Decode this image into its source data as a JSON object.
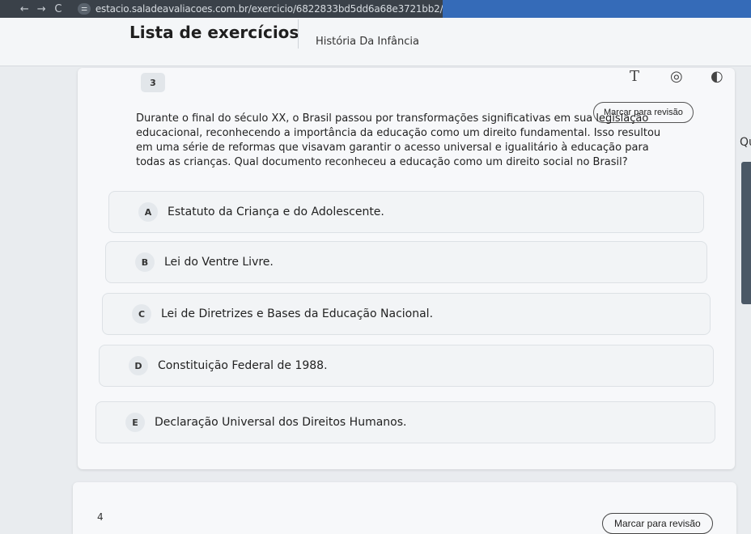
{
  "browser": {
    "url": "estacio.saladeavaliacoes.com.br/exercicio/6822833bd5dd6a68e3721bb2/",
    "back_icon": "←",
    "forward_icon": "→",
    "reload_icon": "C",
    "site_info_icon": "⚌"
  },
  "header": {
    "title": "Lista de exercícios",
    "subject": "História Da Infância"
  },
  "question": {
    "number": "3",
    "mark_label": "Marcar para revisão",
    "text": "Durante o final do século XX, o Brasil passou por transformações significativas em sua legislação educacional, reconhecendo a importância da educação como um direito fundamental. Isso resultou em uma série de reformas que visavam garantir o acesso universal e igualitário à educação para todas as crianças. Qual documento reconheceu a educação como um direito social no Brasil?",
    "options": [
      {
        "letter": "A",
        "text": "Estatuto da Criança e do Adolescente."
      },
      {
        "letter": "B",
        "text": "Lei do Ventre Livre."
      },
      {
        "letter": "C",
        "text": "Lei de Diretrizes e Bases da Educação Nacional."
      },
      {
        "letter": "D",
        "text": "Constituição Federal de 1988."
      },
      {
        "letter": "E",
        "text": "Declaração Universal dos Direitos Humanos."
      }
    ]
  },
  "toolbar": {
    "text_tool_icon": "T",
    "target_icon": "◎",
    "contrast_icon": "◐"
  },
  "side": {
    "partial_text": "Qu"
  },
  "next_question": {
    "number": "4",
    "mark_label": "Marcar para revisão"
  }
}
